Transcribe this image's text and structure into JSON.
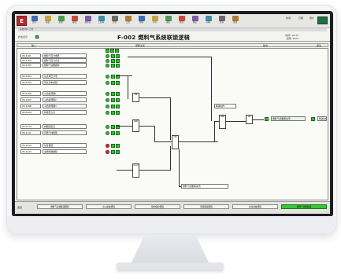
{
  "toolbar": {
    "app_logo_text": "E",
    "buttons": [
      "文件",
      "报表",
      "趋势",
      "报警",
      "操作员",
      "工程师",
      "历史",
      "日志",
      "帮助",
      "打印",
      "退出",
      "复位",
      "确认",
      "切换",
      "登录",
      "注销"
    ],
    "right_status": [
      "时间",
      "日期",
      "用户"
    ]
  },
  "page": {
    "title": "F-002 燃料气系统联锁逻辑",
    "breadcrumb": "系统状态: 正常",
    "left_label": "状态显示",
    "right_info_1": "时间: 10:32",
    "right_info_2": "日期: 2023"
  },
  "header_row": {
    "col1": "输入",
    "col2": "逻辑关系",
    "col3": "输出",
    "col4": "备注"
  },
  "inputs": [
    {
      "tag": "XS-1101",
      "desc": "燃料气压力低低"
    },
    {
      "tag": "XS-1102",
      "desc": "燃料气压力高高"
    },
    {
      "tag": "XS-1103",
      "desc": "燃料气切断阀关"
    },
    {
      "tag": "XS-1104",
      "desc": "仪表风压力低"
    },
    {
      "tag": "XS-1105",
      "desc": "紧急停车按钮"
    },
    {
      "tag": "XS-1106",
      "desc": "火焰检测器1"
    },
    {
      "tag": "XS-1107",
      "desc": "火焰检测器2"
    },
    {
      "tag": "XS-1108",
      "desc": "火焰检测器3"
    },
    {
      "tag": "XS-1109",
      "desc": "炉膛压力高"
    },
    {
      "tag": "XS-1110",
      "desc": "排烟温度高"
    },
    {
      "tag": "XS-1111",
      "desc": "可燃气体报警"
    },
    {
      "tag": "XS-1112",
      "desc": "氧含量低"
    },
    {
      "tag": "XS-1113",
      "desc": "主燃料阀故障"
    }
  ],
  "gates": [
    "OR",
    "AND",
    "2oo3",
    "OR",
    "AND",
    "OR"
  ],
  "output": {
    "label": "燃料气切断阀关闭",
    "note": "联锁动作"
  },
  "footer_tabs": [
    "燃料气系统联锁逻辑",
    "点火系统逻辑",
    "锅炉保护逻辑",
    "风机联锁逻辑",
    "给水系统逻辑",
    "燃料气系统联锁"
  ],
  "footer_left": "返回"
}
